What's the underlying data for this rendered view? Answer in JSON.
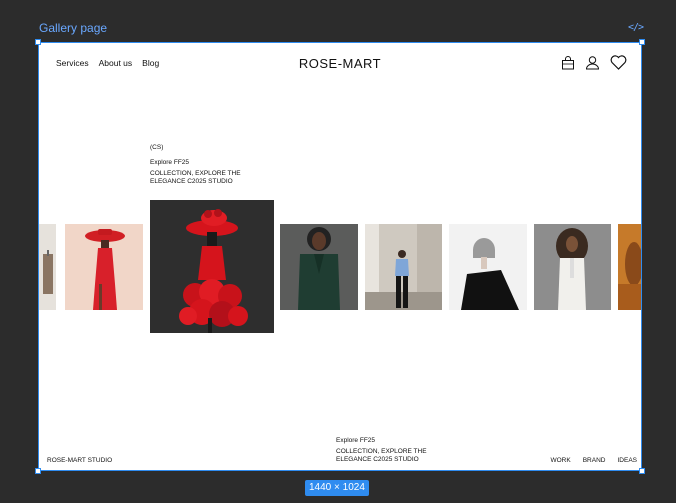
{
  "editor": {
    "frame_label": "Gallery page",
    "dimensions": "1440 × 1024",
    "code_icon": "</>",
    "accent": "#2f8cf0"
  },
  "site": {
    "nav": [
      "Services",
      "About us",
      "Blog"
    ],
    "brand": "ROSE-MART",
    "icons": [
      "bag-icon",
      "user-icon",
      "heart-icon"
    ]
  },
  "feature": {
    "tag": "(CS)",
    "title": "Explore FF25",
    "caption": "COLLECTION, EXPLORE THE ELEGANCE c2025 STUDIO"
  },
  "gallery": {
    "items": [
      {
        "name": "rack-photo"
      },
      {
        "name": "red-hat-dress-photo"
      },
      {
        "name": "red-rose-gown-photo"
      },
      {
        "name": "green-suit-photo"
      },
      {
        "name": "blue-shirt-photo"
      },
      {
        "name": "black-dress-bob-photo"
      },
      {
        "name": "white-outfit-photo"
      },
      {
        "name": "orange-portrait-photo"
      }
    ]
  },
  "footer": {
    "studio": "ROSE-MART STUDIO",
    "title": "Explore FF25",
    "caption": "COLLECTION, EXPLORE THE ELEGANCE c2025 STUDIO",
    "links": [
      "WORK",
      "BRAND",
      "IDEAS"
    ]
  }
}
